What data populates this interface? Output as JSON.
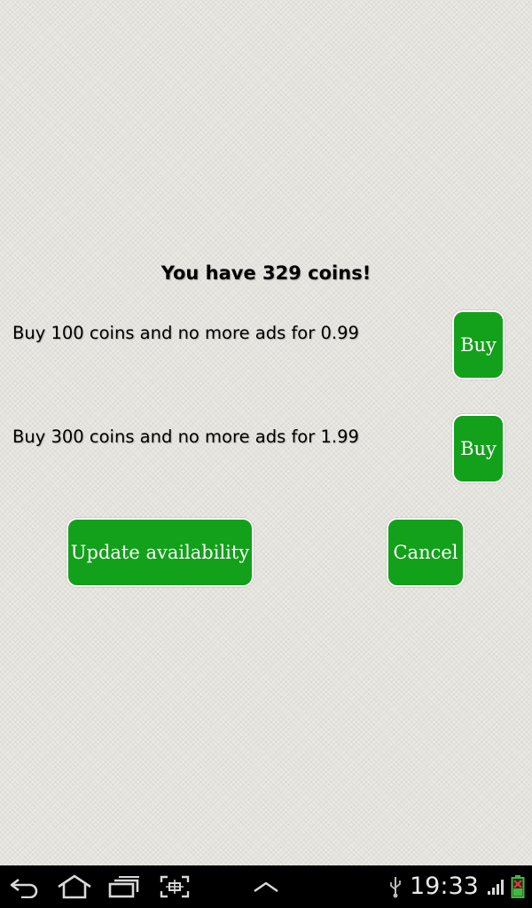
{
  "coins": {
    "title": "You have 329 coins!"
  },
  "offers": [
    {
      "text": "Buy 100 coins and no more ads for 0.99",
      "button_label": "Buy"
    },
    {
      "text": "Buy 300 coins and no more ads for 1.99",
      "button_label": "Buy"
    }
  ],
  "actions": {
    "update_label": "Update availability",
    "cancel_label": "Cancel"
  },
  "status_bar": {
    "time": "19:33",
    "icons": [
      "back-icon",
      "home-icon",
      "recent-apps-icon",
      "screenshot-icon",
      "up-arrow-icon",
      "usb-icon",
      "signal-icon",
      "battery-icon"
    ]
  },
  "colors": {
    "button_green": "#13a01b",
    "background": "#e9e8e2",
    "navbar": "#000000"
  }
}
